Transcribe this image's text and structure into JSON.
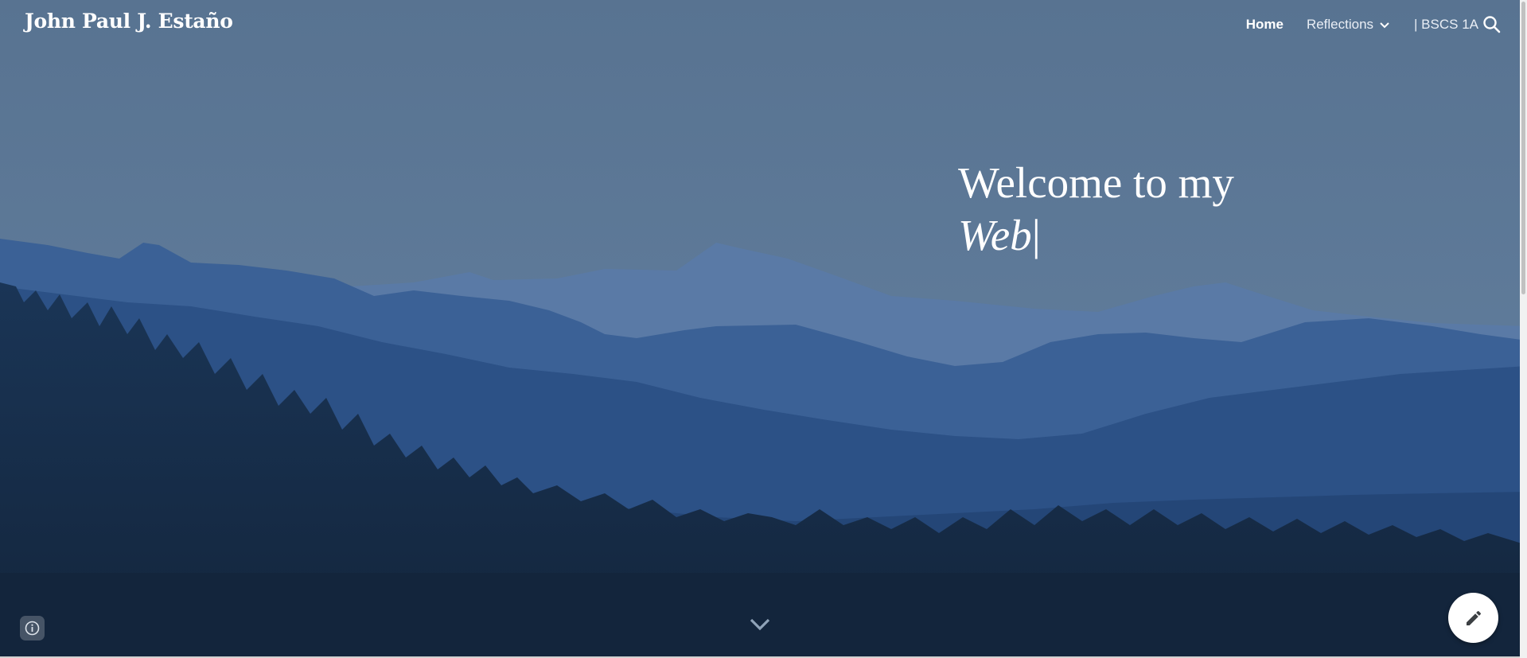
{
  "site": {
    "title": "John Paul J. Estaño"
  },
  "nav": {
    "items": [
      {
        "label": "Home",
        "active": true
      },
      {
        "label": "Reflections",
        "has_dropdown": true
      },
      {
        "label": "| BSCS 1A"
      }
    ],
    "search_icon": "search-icon"
  },
  "hero": {
    "headline_line1": "Welcome to my",
    "headline_typed": "Web",
    "cursor": "|",
    "background": "mountain-forest-landscape"
  },
  "controls": {
    "scroll_icon": "chevron-down-icon",
    "info_icon": "info-icon",
    "edit_icon": "pencil-icon"
  },
  "colors": {
    "sky": "#5d7897",
    "mountains": "#2f5487",
    "forest": "#142a45",
    "text": "#ffffff"
  }
}
